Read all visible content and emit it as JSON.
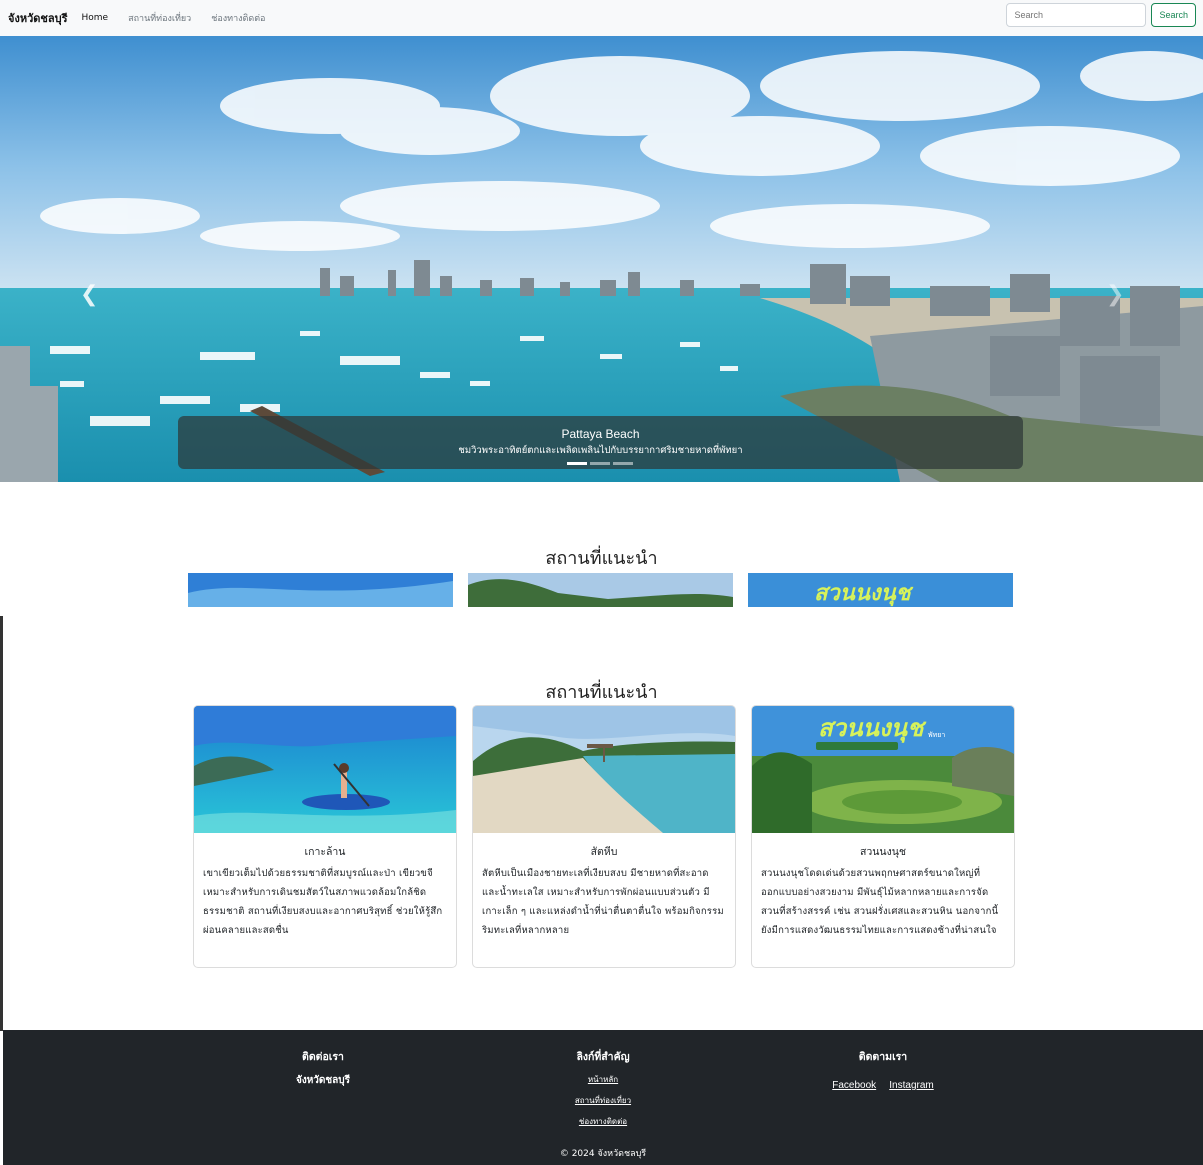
{
  "navbar": {
    "brand": "จังหวัดชลบุรี",
    "links": [
      "Home",
      "สถานที่ท่องเที่ยว",
      "ช่องทางติดต่อ"
    ],
    "search_placeholder": "Search",
    "search_button": "Search"
  },
  "hero": {
    "caption_title": "Pattaya Beach",
    "caption_subtitle": "ชมวิวพระอาทิตย์ตกและเพลิดเพลินไปกับบรรยากาศริมชายหาดที่พัทยา",
    "indicators": 3,
    "active_indicator": 0
  },
  "section": {
    "title": "สถานที่แนะนำ"
  },
  "cards": [
    {
      "title": "เกาะล้าน",
      "text": "เขาเขียวเต็มไปด้วยธรรมชาติที่สมบูรณ์และป่า เขียวขจี เหมาะสำหรับการเดินชมสัตว์ในสภาพแวดล้อมใกล้ชิดธรรมชาติ สถานที่เงียบสงบและอากาศบริสุทธิ์ ช่วยให้รู้สึกผ่อนคลายและสดชื่น",
      "image": "island-kayak"
    },
    {
      "title": "สัตหีบ",
      "text": "สัตหีบเป็นเมืองชายทะเลที่เงียบสงบ มีชายหาดที่สะอาดและน้ำทะเลใส เหมาะสำหรับการพักผ่อนแบบส่วนตัว มีเกาะเล็ก ๆ และแหล่งดำน้ำที่น่าตื่นตาตื่นใจ พร้อมกิจกรรมริมทะเลที่หลากหลาย",
      "image": "beach-pier"
    },
    {
      "title": "สวนนงนุช",
      "text": "สวนนงนุชโดดเด่นด้วยสวนพฤกษศาสตร์ขนาดใหญ่ที่ออกแบบอย่างสวยงาม มีพันธุ์ไม้หลากหลายและการจัดสวนที่สร้างสรรค์ เช่น สวนฝรั่งเศสและสวนหิน นอกจากนี้ยังมีการแสดงวัฒนธรรมไทยและการแสดงช้างที่น่าสนใจ",
      "image": "garden",
      "logo_text": "สวนนงนุช",
      "logo_sub": "พัทยา"
    }
  ],
  "footer": {
    "contact_heading": "ติดต่อเรา",
    "contact_text": "จังหวัดชลบุรี",
    "links_heading": "ลิงก์ที่สำคัญ",
    "links": [
      "หน้าหลัก",
      "สถานที่ท่องเที่ยว",
      "ช่องทางติดต่อ"
    ],
    "follow_heading": "ติดตามเรา",
    "social": [
      "Facebook",
      "Instagram"
    ],
    "copyright": "© 2024 จังหวัดชลบุรี"
  },
  "colors": {
    "navbar_bg": "#f8f9fa",
    "search_button": "#198754",
    "footer_bg": "#212529"
  }
}
